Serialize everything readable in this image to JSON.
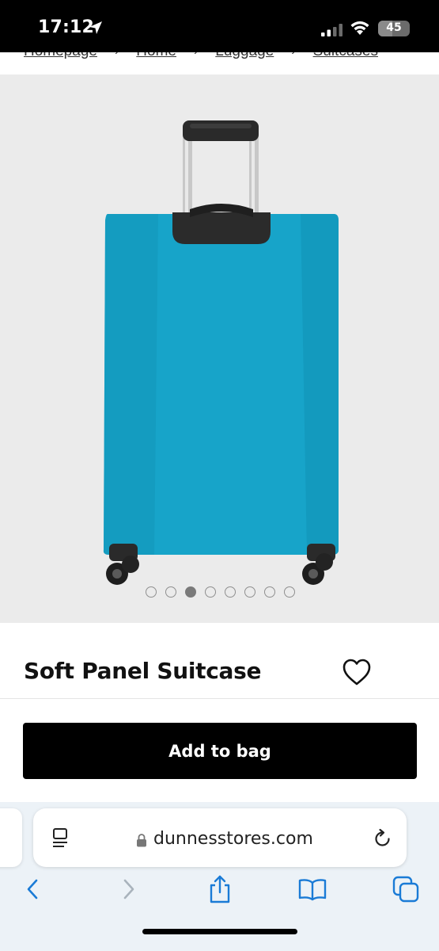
{
  "status_bar": {
    "time": "17:12",
    "battery": "45",
    "battery_level": 0.45,
    "icons": [
      "location-arrow-icon",
      "cellular-signal-icon",
      "wifi-icon",
      "battery-icon"
    ]
  },
  "breadcrumb": {
    "items": [
      "Homepage",
      "Home",
      "Luggage",
      "Suitcases"
    ],
    "separator": "›"
  },
  "gallery": {
    "image_alt": "Teal suitcase back view",
    "image_count": 8,
    "active_index": 2,
    "colors": {
      "suitcase": "#1aa3c8",
      "background": "#ebebeb"
    }
  },
  "product": {
    "title": "Soft Panel Suitcase",
    "wishlist_icon": "heart-outline-icon"
  },
  "actions": {
    "add_to_bag": "Add to bag"
  },
  "browser": {
    "url": "dunnesstores.com",
    "icons": {
      "reader": "page-format-icon",
      "lock": "lock-icon",
      "reload": "reload-icon",
      "back": "chevron-left-icon",
      "forward": "chevron-right-icon",
      "share": "share-icon",
      "bookmarks": "book-icon",
      "tabs": "tabs-icon"
    },
    "accent": "#1a7bd6"
  }
}
